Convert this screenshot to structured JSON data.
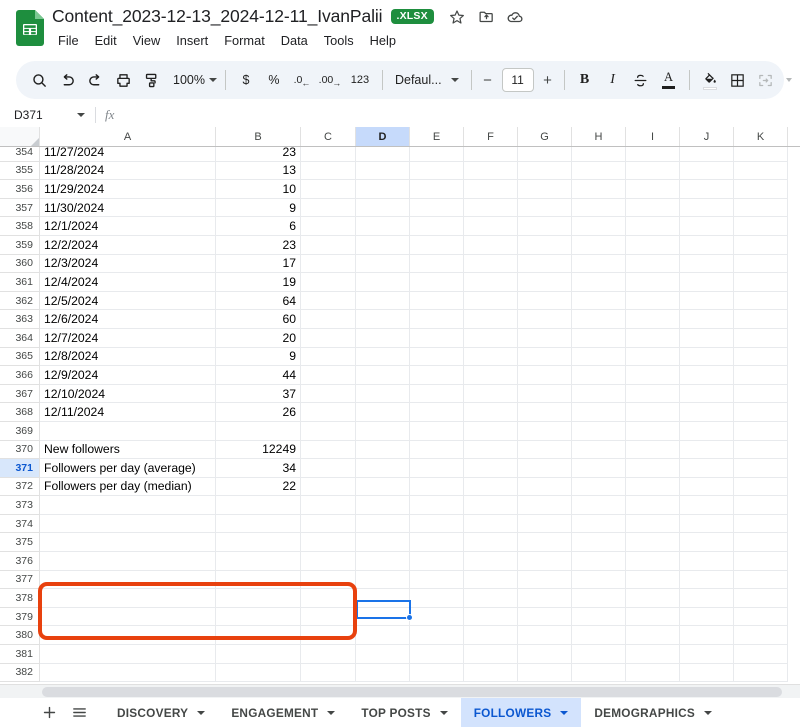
{
  "document": {
    "title": "Content_2023-12-13_2024-12-11_IvanPalii",
    "format_badge": ".XLSX"
  },
  "title_icons": [
    {
      "name": "star-icon",
      "label": "Star"
    },
    {
      "name": "move-to-folder-icon",
      "label": "Move"
    },
    {
      "name": "cloud-saved-icon",
      "label": "Saved to Drive"
    }
  ],
  "menus": [
    {
      "label": "File"
    },
    {
      "label": "Edit"
    },
    {
      "label": "View"
    },
    {
      "label": "Insert"
    },
    {
      "label": "Format"
    },
    {
      "label": "Data"
    },
    {
      "label": "Tools"
    },
    {
      "label": "Help"
    }
  ],
  "toolbar": {
    "search_icon": "search-icon",
    "undo_icon": "undo-icon",
    "redo_icon": "redo-icon",
    "print_icon": "print-icon",
    "paint_format_icon": "paint-format-icon",
    "zoom_value": "100%",
    "currency_label": "$",
    "percent_label": "%",
    "decrease_decimal_label": ".0",
    "increase_decimal_label": ".00",
    "more_formats_label": "123",
    "font_name": "Defaul...",
    "decrease_font_label": "−",
    "font_size": "11",
    "increase_font_label": "+",
    "bold_label": "B",
    "italic_label": "I",
    "strikethrough_icon": "strikethrough-icon",
    "text_color_label": "A",
    "fill_color_icon": "fill-color-icon",
    "borders_icon": "borders-icon",
    "merge_cells_icon": "merge-cells-icon"
  },
  "formula_bar": {
    "name_box": "D371",
    "fx_label": "fx",
    "formula_value": ""
  },
  "grid": {
    "columns": [
      "A",
      "B",
      "C",
      "D",
      "E",
      "F",
      "G",
      "H",
      "I",
      "J",
      "K"
    ],
    "selected_column": "D",
    "selected_row": "371",
    "selected_cell": "D371",
    "rows": [
      {
        "num": "354",
        "a": "11/27/2024",
        "b": "23"
      },
      {
        "num": "355",
        "a": "11/28/2024",
        "b": "13"
      },
      {
        "num": "356",
        "a": "11/29/2024",
        "b": "10"
      },
      {
        "num": "357",
        "a": "11/30/2024",
        "b": "9"
      },
      {
        "num": "358",
        "a": "12/1/2024",
        "b": "6"
      },
      {
        "num": "359",
        "a": "12/2/2024",
        "b": "23"
      },
      {
        "num": "360",
        "a": "12/3/2024",
        "b": "17"
      },
      {
        "num": "361",
        "a": "12/4/2024",
        "b": "19"
      },
      {
        "num": "362",
        "a": "12/5/2024",
        "b": "64"
      },
      {
        "num": "363",
        "a": "12/6/2024",
        "b": "60"
      },
      {
        "num": "364",
        "a": "12/7/2024",
        "b": "20"
      },
      {
        "num": "365",
        "a": "12/8/2024",
        "b": "9"
      },
      {
        "num": "366",
        "a": "12/9/2024",
        "b": "44"
      },
      {
        "num": "367",
        "a": "12/10/2024",
        "b": "37"
      },
      {
        "num": "368",
        "a": "12/11/2024",
        "b": "26"
      },
      {
        "num": "369",
        "a": "",
        "b": ""
      },
      {
        "num": "370",
        "a": "New followers",
        "b": "12249"
      },
      {
        "num": "371",
        "a": "Followers per day (average)",
        "b": "34"
      },
      {
        "num": "372",
        "a": "Followers per day (median)",
        "b": "22"
      },
      {
        "num": "373",
        "a": "",
        "b": ""
      },
      {
        "num": "374",
        "a": "",
        "b": ""
      },
      {
        "num": "375",
        "a": "",
        "b": ""
      },
      {
        "num": "376",
        "a": "",
        "b": ""
      },
      {
        "num": "377",
        "a": "",
        "b": ""
      },
      {
        "num": "378",
        "a": "",
        "b": ""
      },
      {
        "num": "379",
        "a": "",
        "b": ""
      },
      {
        "num": "380",
        "a": "",
        "b": ""
      },
      {
        "num": "381",
        "a": "",
        "b": ""
      },
      {
        "num": "382",
        "a": "",
        "b": ""
      }
    ]
  },
  "annotation": {
    "color": "#e8410e",
    "highlighted_rows": [
      "370",
      "371",
      "372"
    ]
  },
  "sheet_tabs": {
    "add_sheet_icon": "plus-icon",
    "all_sheets_icon": "hamburger-menu-icon",
    "tabs": [
      {
        "label": "DISCOVERY",
        "active": false
      },
      {
        "label": "ENGAGEMENT",
        "active": false
      },
      {
        "label": "TOP POSTS",
        "active": false
      },
      {
        "label": "FOLLOWERS",
        "active": true
      },
      {
        "label": "DEMOGRAPHICS",
        "active": false
      }
    ]
  },
  "colors": {
    "accent": "#0b57d0",
    "selection": "#1a73e8",
    "sheets_green": "#1e8e3e",
    "annotation_red": "#e8410e"
  }
}
